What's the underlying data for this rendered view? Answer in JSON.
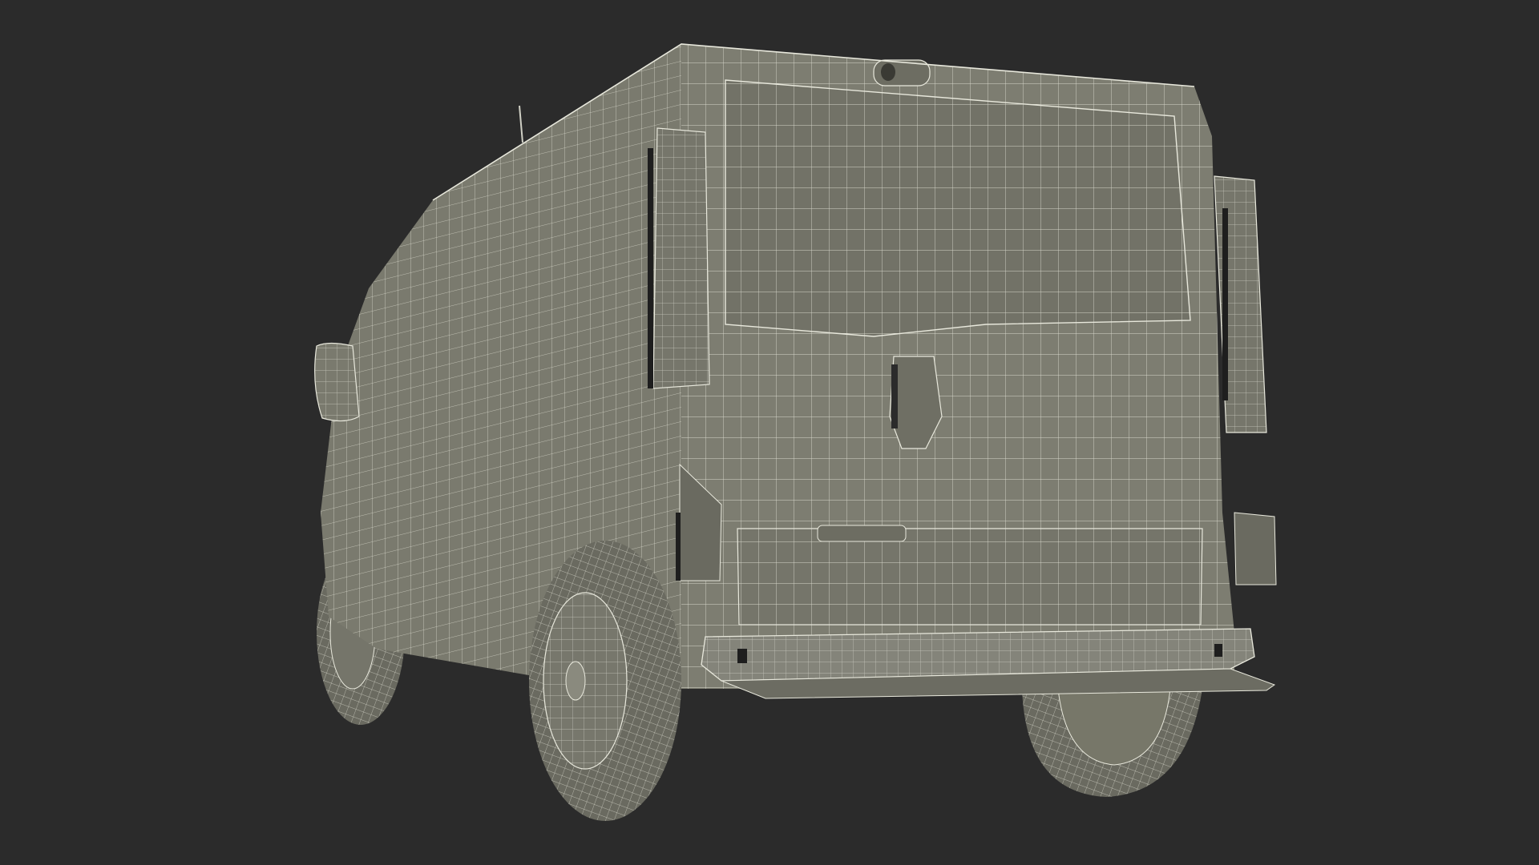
{
  "scene": {
    "background_color": "#2b2b2b",
    "body_color": "#7a7a6e",
    "body_shadow_color": "#5f5f55",
    "wire_color": "#e8e8dc",
    "tire_color": "#6a6a60",
    "subject": "wireframe-van-rear-view-icon"
  }
}
